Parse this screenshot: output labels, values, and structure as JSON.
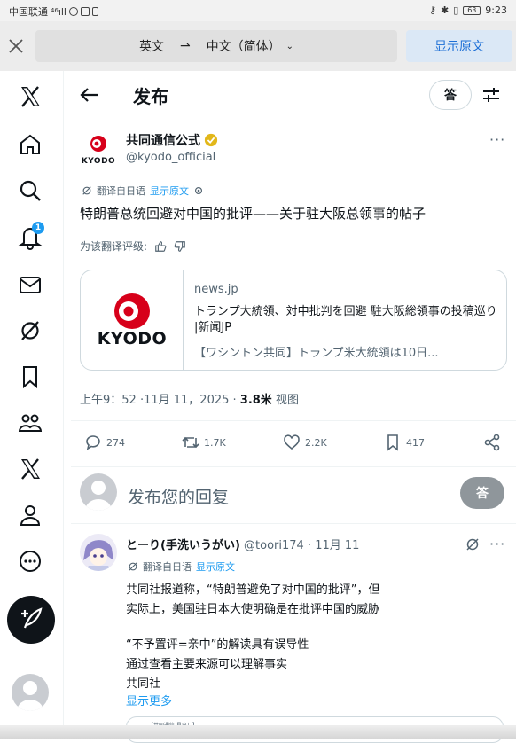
{
  "status_bar": {
    "carrier": "中国联通",
    "signal": "⁴⁶ıll",
    "battery": "63",
    "time": "9:23"
  },
  "translate_bar": {
    "source_lang": "英文",
    "arrow": "⇀",
    "target_lang": "中文（简体）",
    "show_original": "显示原文"
  },
  "header": {
    "title": "发布",
    "answer_btn": "答"
  },
  "sidebar": {
    "notification_count": "1",
    "icons": [
      "x-logo-icon",
      "home-icon",
      "search-icon",
      "bell-icon",
      "mail-icon",
      "grok-icon",
      "bookmark-icon",
      "communities-icon",
      "premium-x-icon",
      "profile-icon",
      "more-icon"
    ]
  },
  "tweet": {
    "author_name": "共同通信公式",
    "author_handle": "@kyodo_official",
    "logo_text": "KYODO",
    "translated_from": "翻译自日语",
    "show_original": "显示原文",
    "text": "特朗普总统回避对中国的批评——关于驻大阪总领事的帖子",
    "rate_translation": "为该翻译评级:",
    "card": {
      "logo_text": "KYODO",
      "domain": "news.jp",
      "title": "トランプ大統領、対中批判を回避 駐大阪総領事の投稿巡り |新闻JP",
      "desc": "【ワシントン共同】トランプ米大統領は10日..."
    },
    "time": "上午9：52 ·11月 11，2025 · ",
    "views": "3.8米",
    "views_label": " 视图",
    "counts": {
      "replies": "274",
      "retweets": "1.7K",
      "likes": "2.2K",
      "bookmarks": "417"
    }
  },
  "reply_composer": {
    "placeholder": "发布您的回复",
    "button": "答"
  },
  "reply": {
    "name": "とーり(手洗いうがい)",
    "handle": " @toori174 · 11月 11",
    "translated_from": "翻译自日语",
    "show_original": "显示原文",
    "lines": [
      "共同社报道称，“特朗普避免了对中国的批评”，但",
      "实际上，美国驻日本大使明确是在批评中国的威胁",
      "",
      "“不予置评=亲中”的解读具有误导性",
      "通过查看主要来源可以理解事实",
      "共同社"
    ],
    "show_more": "显示更多",
    "embed_caption": "【共同通信 見出し】"
  }
}
